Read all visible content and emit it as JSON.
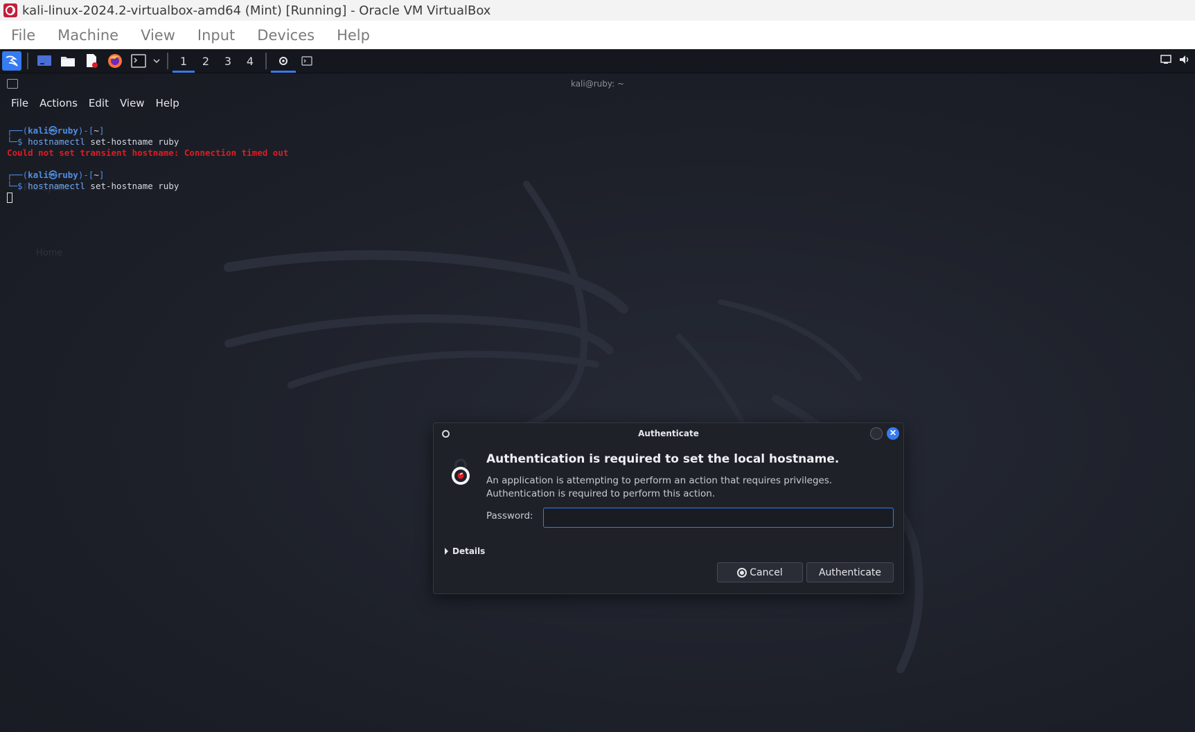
{
  "host": {
    "window_title": "kali-linux-2024.2-virtualbox-amd64 (Mint) [Running] - Oracle VM VirtualBox",
    "menu": [
      "File",
      "Machine",
      "View",
      "Input",
      "Devices",
      "Help"
    ]
  },
  "panel": {
    "workspaces": [
      "1",
      "2",
      "3",
      "4"
    ],
    "active_workspace": "1"
  },
  "terminal": {
    "title": "kali@ruby: ~",
    "menu": [
      "File",
      "Actions",
      "Edit",
      "View",
      "Help"
    ],
    "lines": [
      {
        "corner": "┌──(",
        "user": "kali㉿ruby",
        "close": ")-[",
        "dir": "~",
        "end": "]"
      },
      {
        "prompt": "└─$ ",
        "cmd": "hostnamectl",
        "args": " set-hostname ruby"
      },
      {
        "error": "Could not set transient hostname: Connection timed out"
      },
      {
        "corner": "┌──(",
        "user": "kali㉿ruby",
        "close": ")-[",
        "dir": "~",
        "end": "]"
      },
      {
        "prompt": "└─$ ",
        "cmd": "hostnamectl",
        "args": " set-hostname ruby"
      }
    ]
  },
  "desktop_icons": [
    "File System",
    "Home"
  ],
  "dialog": {
    "title": "Authenticate",
    "heading": "Authentication is required to set the local hostname.",
    "description": "An application is attempting to perform an action that requires privileges. Authentication is required to perform this action.",
    "password_label": "Password:",
    "password_value": "",
    "details_label": "Details",
    "cancel_label": "Cancel",
    "authenticate_label": "Authenticate",
    "close_glyph": "✕"
  },
  "colors": {
    "accent": "#367bf0",
    "error": "#e01b24",
    "prompt": "#4d8fe6"
  }
}
